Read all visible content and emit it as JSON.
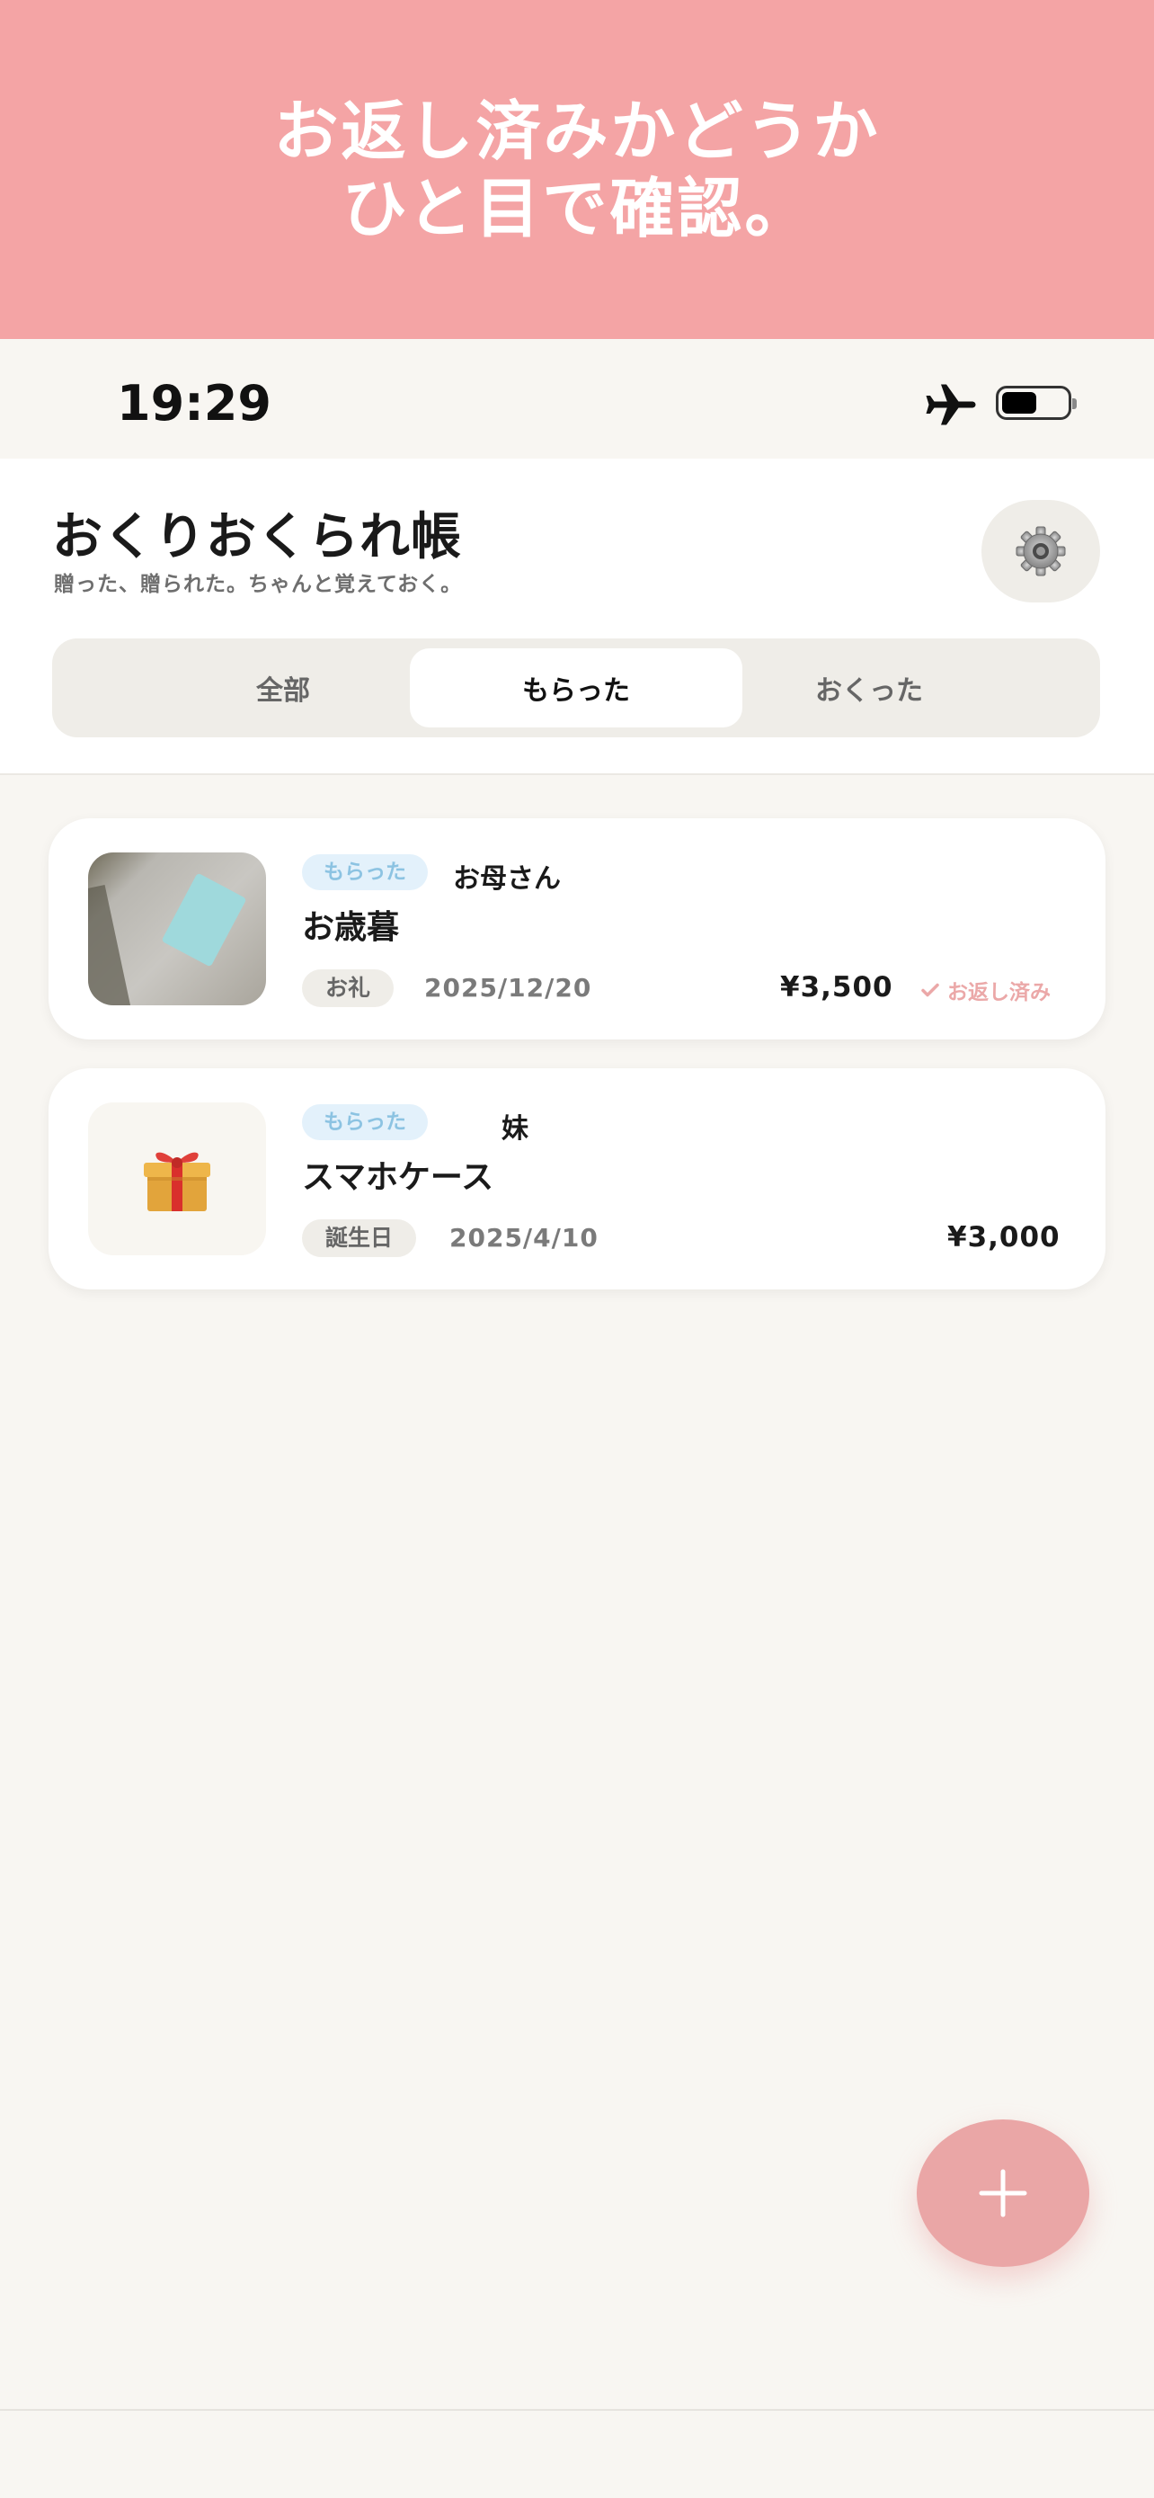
{
  "promo": {
    "text": "お返し済みかどうか\nひと目で確認。"
  },
  "status_bar": {
    "time": "19:29",
    "icons": [
      "airplane-icon",
      "battery-icon"
    ]
  },
  "header": {
    "title": "おくりおくられ帳",
    "subtitle": "贈った、贈られた。ちゃんと覚えておく。",
    "settings_icon": "gear-icon"
  },
  "tabs": [
    {
      "label": "全部",
      "active": false
    },
    {
      "label": "もらった",
      "active": true
    },
    {
      "label": "おくった",
      "active": false
    }
  ],
  "entries": [
    {
      "direction": "もらった",
      "person": "お母さん",
      "item": "お歳暮",
      "occasion": "お礼",
      "date": "2025/12/20",
      "amount": "¥3,500",
      "status": "お返し済み",
      "thumbnail": "photo"
    },
    {
      "direction": "もらった",
      "person": "妹",
      "item": "スマホケース",
      "occasion": "誕生日",
      "date": "2025/4/10",
      "amount": "¥3,000",
      "thumbnail": "gift-icon"
    }
  ],
  "fab": {
    "icon": "plus-icon"
  },
  "colors": {
    "accent": "#eaa6a6",
    "banner": "#f4a4a5",
    "tag_bg": "#e3f1fb",
    "tag_text": "#8cc3e2"
  }
}
